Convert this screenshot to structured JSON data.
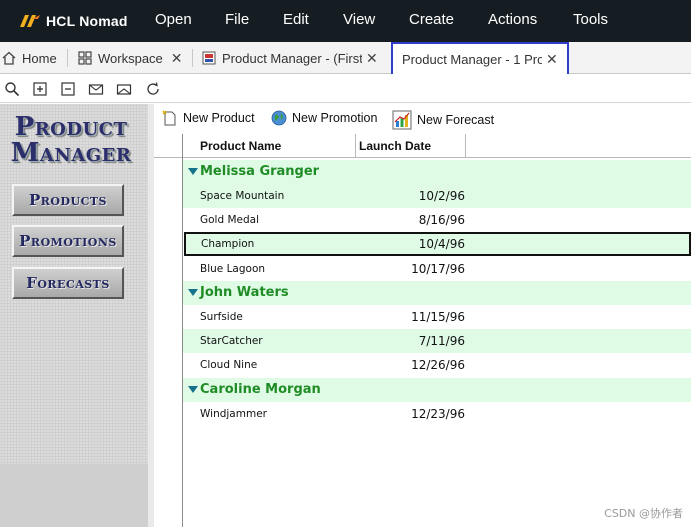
{
  "app": {
    "name": "HCL Nomad"
  },
  "menu": [
    "Open",
    "File",
    "Edit",
    "View",
    "Create",
    "Actions",
    "Tools"
  ],
  "tabs": [
    {
      "label": "Home",
      "icon": "home-icon"
    },
    {
      "label": "Workspace",
      "icon": "grid-icon",
      "close": "✕"
    },
    {
      "label": "Product Manager - (First",
      "icon": "database-icon",
      "close": "✕"
    },
    {
      "label": "Product Manager - 1 Pro",
      "close": "✕",
      "active": true
    }
  ],
  "small_toolbar": [
    "search-icon",
    "add-window-icon",
    "remove-window-icon",
    "mail-in-icon",
    "mail-out-icon",
    "refresh-icon"
  ],
  "nav": {
    "title_line1": "Product",
    "title_line2": "Manager",
    "buttons": [
      "Products",
      "Promotions",
      "Forecasts"
    ]
  },
  "actions": [
    {
      "label": "New Product",
      "icon": "new-document-icon"
    },
    {
      "label": "New Promotion",
      "icon": "globe-icon"
    },
    {
      "label": "New Forecast",
      "icon": "chart-icon"
    }
  ],
  "view": {
    "columns": [
      "Product Name",
      "Launch Date"
    ],
    "categories": [
      {
        "name": "Melissa Granger",
        "rows": [
          {
            "name": "Space Mountain",
            "date": "10/2/96"
          },
          {
            "name": "Gold Medal",
            "date": "8/16/96"
          },
          {
            "name": "Champion",
            "date": "10/4/96"
          },
          {
            "name": "Blue Lagoon",
            "date": "10/17/96"
          }
        ]
      },
      {
        "name": "John Waters",
        "rows": [
          {
            "name": "Surfside",
            "date": "11/15/96"
          },
          {
            "name": "StarCatcher",
            "date": "7/11/96"
          },
          {
            "name": "Cloud Nine",
            "date": "12/26/96"
          }
        ]
      },
      {
        "name": "Caroline Morgan",
        "rows": [
          {
            "name": "Windjammer",
            "date": "12/23/96"
          }
        ]
      }
    ],
    "selected_row": "Champion"
  },
  "colors": {
    "menubar": "#161d22",
    "accent_tab": "#2f3fc7",
    "category_text": "#1f8c25",
    "row_highlight": "#dffbe6"
  },
  "watermark": "CSDN @协作者"
}
